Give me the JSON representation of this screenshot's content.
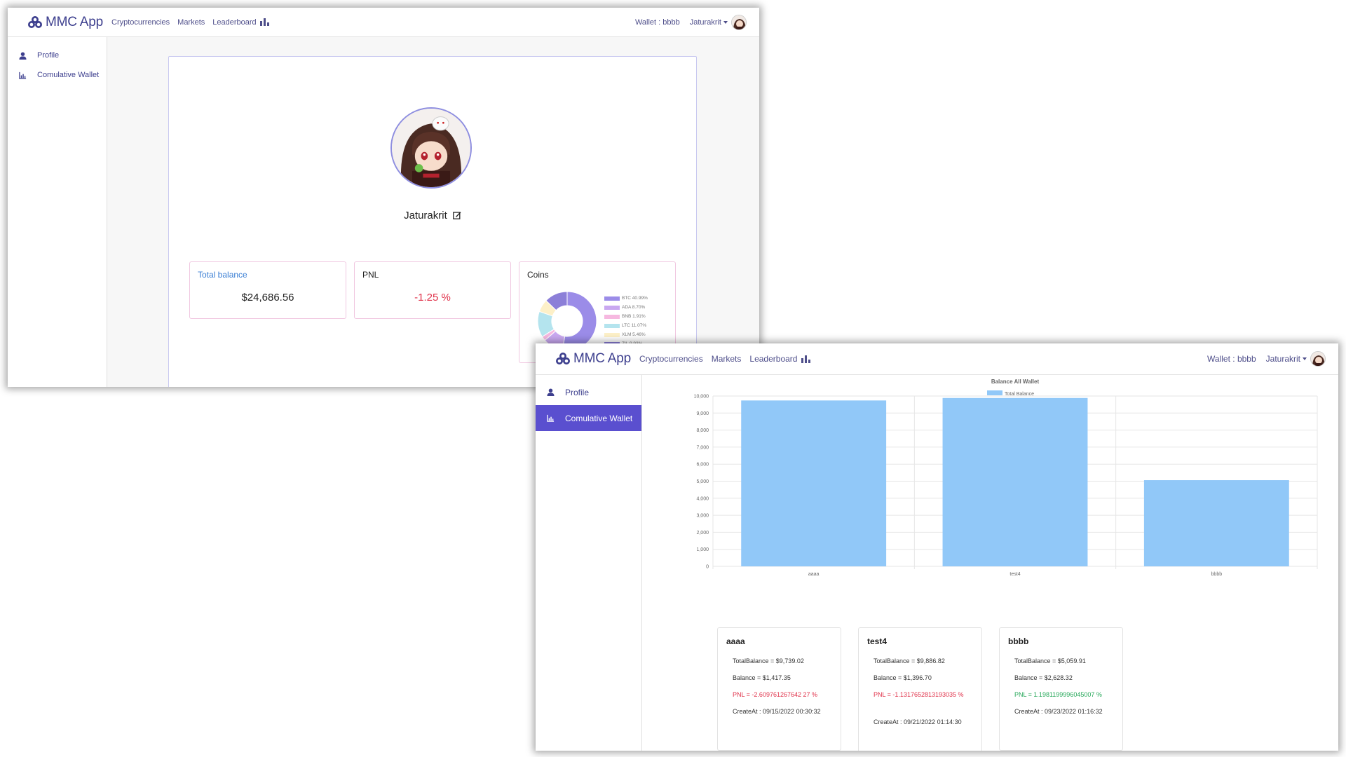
{
  "profile_window": {
    "navbar": {
      "brand": "MMC App",
      "links": [
        "Cryptocurrencies",
        "Markets",
        "Leaderboard"
      ],
      "wallet": "Wallet : bbbb",
      "user": "Jaturakrit"
    },
    "sidebar": {
      "items": [
        {
          "label": "Profile",
          "icon": "user-icon"
        },
        {
          "label": "Comulative Wallet",
          "icon": "chart-icon"
        }
      ]
    },
    "profile": {
      "name": "Jaturakrit",
      "total_balance_label": "Total balance",
      "total_balance_value": "$24,686.56",
      "pnl_label": "PNL",
      "pnl_value": "-1.25 %",
      "coins_label": "Coins",
      "coins": [
        {
          "label": "BTC 40.99%",
          "value": 40.99,
          "color": "#9b8ce8"
        },
        {
          "label": "ADA 8.70%",
          "value": 8.7,
          "color": "#c9a8f0"
        },
        {
          "label": "BNB 1.91%",
          "value": 1.91,
          "color": "#f6b8e0"
        },
        {
          "label": "LTC 11.07%",
          "value": 11.07,
          "color": "#b4e4ee"
        },
        {
          "label": "XLM 5.46%",
          "value": 5.46,
          "color": "#fdf0c8"
        },
        {
          "label": "ZIL 9.93%",
          "value": 9.93,
          "color": "#8c7fd8"
        }
      ]
    }
  },
  "wallet_window": {
    "navbar": {
      "brand": "MMC App",
      "links": [
        "Cryptocurrencies",
        "Markets",
        "Leaderboard"
      ],
      "wallet": "Wallet : bbbb",
      "user": "Jaturakrit"
    },
    "sidebar": {
      "items": [
        {
          "label": "Profile",
          "icon": "user-icon"
        },
        {
          "label": "Comulative Wallet",
          "icon": "chart-icon",
          "active": true
        }
      ]
    },
    "chart_data": {
      "type": "bar",
      "title": "Balance All Wallet",
      "series": [
        {
          "name": "Total Balance",
          "values": [
            9739.02,
            9886.82,
            5059.91
          ]
        }
      ],
      "categories": [
        "aaaa",
        "test4",
        "bbbb"
      ],
      "ylim": [
        0,
        10000
      ],
      "yticks": [
        "0",
        "1,000",
        "2,000",
        "3,000",
        "4,000",
        "5,000",
        "6,000",
        "7,000",
        "8,000",
        "9,000",
        "10,000"
      ],
      "color": "#91c8f8",
      "grid": true,
      "legend": "top"
    },
    "wallets": [
      {
        "name": "aaaa",
        "total_balance": "TotalBalance = $9,739.02",
        "balance": "Balance = $1,417.35",
        "pnl": "PNL = -2.609761267642 27 %",
        "pnl_status": "negative",
        "created": "CreateAt : 09/15/2022 00:30:32"
      },
      {
        "name": "test4",
        "total_balance": "TotalBalance = $9,886.82",
        "balance": "Balance = $1,396.70",
        "pnl": "PNL = -1.1317652813193035 %",
        "pnl_status": "negative",
        "created": "CreateAt : 09/21/2022 01:14:30"
      },
      {
        "name": "bbbb",
        "total_balance": "TotalBalance = $5,059.91",
        "balance": "Balance = $2,628.32",
        "pnl": "PNL = 1.1981199996045007 %",
        "pnl_status": "positive",
        "created": "CreateAt : 09/23/2022 01:16:32"
      }
    ]
  }
}
